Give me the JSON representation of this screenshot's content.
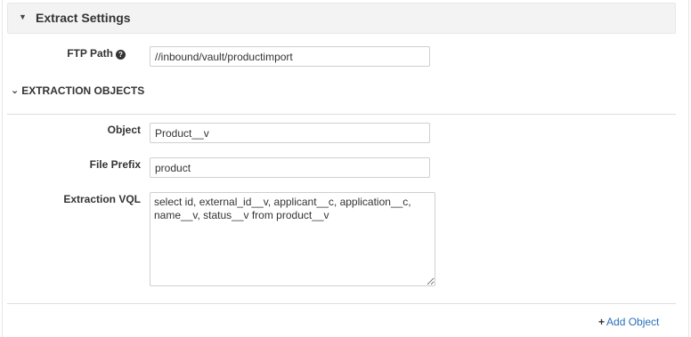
{
  "extract_settings": {
    "title": "Extract Settings",
    "caret_icon": "caret-down-icon"
  },
  "ftp": {
    "label": "FTP Path",
    "help_icon": "?",
    "value": "//inbound/vault/productimport"
  },
  "extraction_objects": {
    "title": "EXTRACTION OBJECTS",
    "chevron": "⌄"
  },
  "object": {
    "label": "Object",
    "value": "Product__v"
  },
  "file_prefix": {
    "label": "File Prefix",
    "value": "product"
  },
  "extraction_vql": {
    "label": "Extraction VQL",
    "value": "select id, external_id__v, applicant__c, application__c, name__v, status__v from product__v"
  },
  "add_object": {
    "plus": "+",
    "label": "Add Object"
  }
}
